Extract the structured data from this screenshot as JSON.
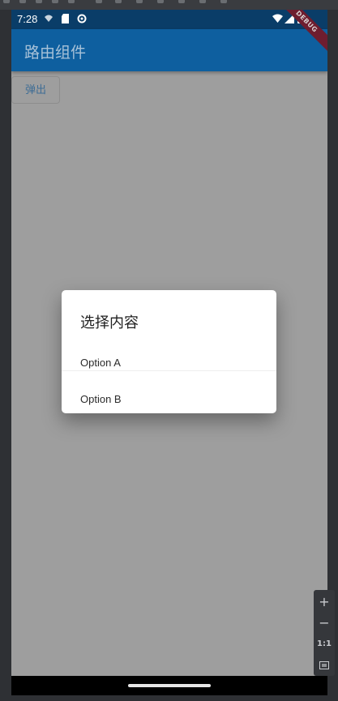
{
  "status_bar": {
    "time": "7:28",
    "left_icons": [
      "wifi-calling-icon",
      "sd-card-icon",
      "settings-icon"
    ],
    "right_icons": [
      "wifi-icon",
      "signal-icon",
      "battery-icon"
    ]
  },
  "appbar": {
    "title": "路由组件",
    "debug_banner": "DEBUG"
  },
  "main": {
    "popup_button_label": "弹出"
  },
  "dialog": {
    "title": "选择内容",
    "options": [
      {
        "label": "Option A"
      },
      {
        "label": "Option B"
      }
    ]
  },
  "emulator": {
    "zoom_in": "+",
    "zoom_out": "−",
    "reset_zoom": "1:1",
    "fit_icon": "fit-screen-icon"
  },
  "colors": {
    "appbar": "#0e5f9f",
    "status_bar": "#0a3d68",
    "scrim": "#9e9e9e",
    "debug_ribbon": "#6e1d2f"
  }
}
